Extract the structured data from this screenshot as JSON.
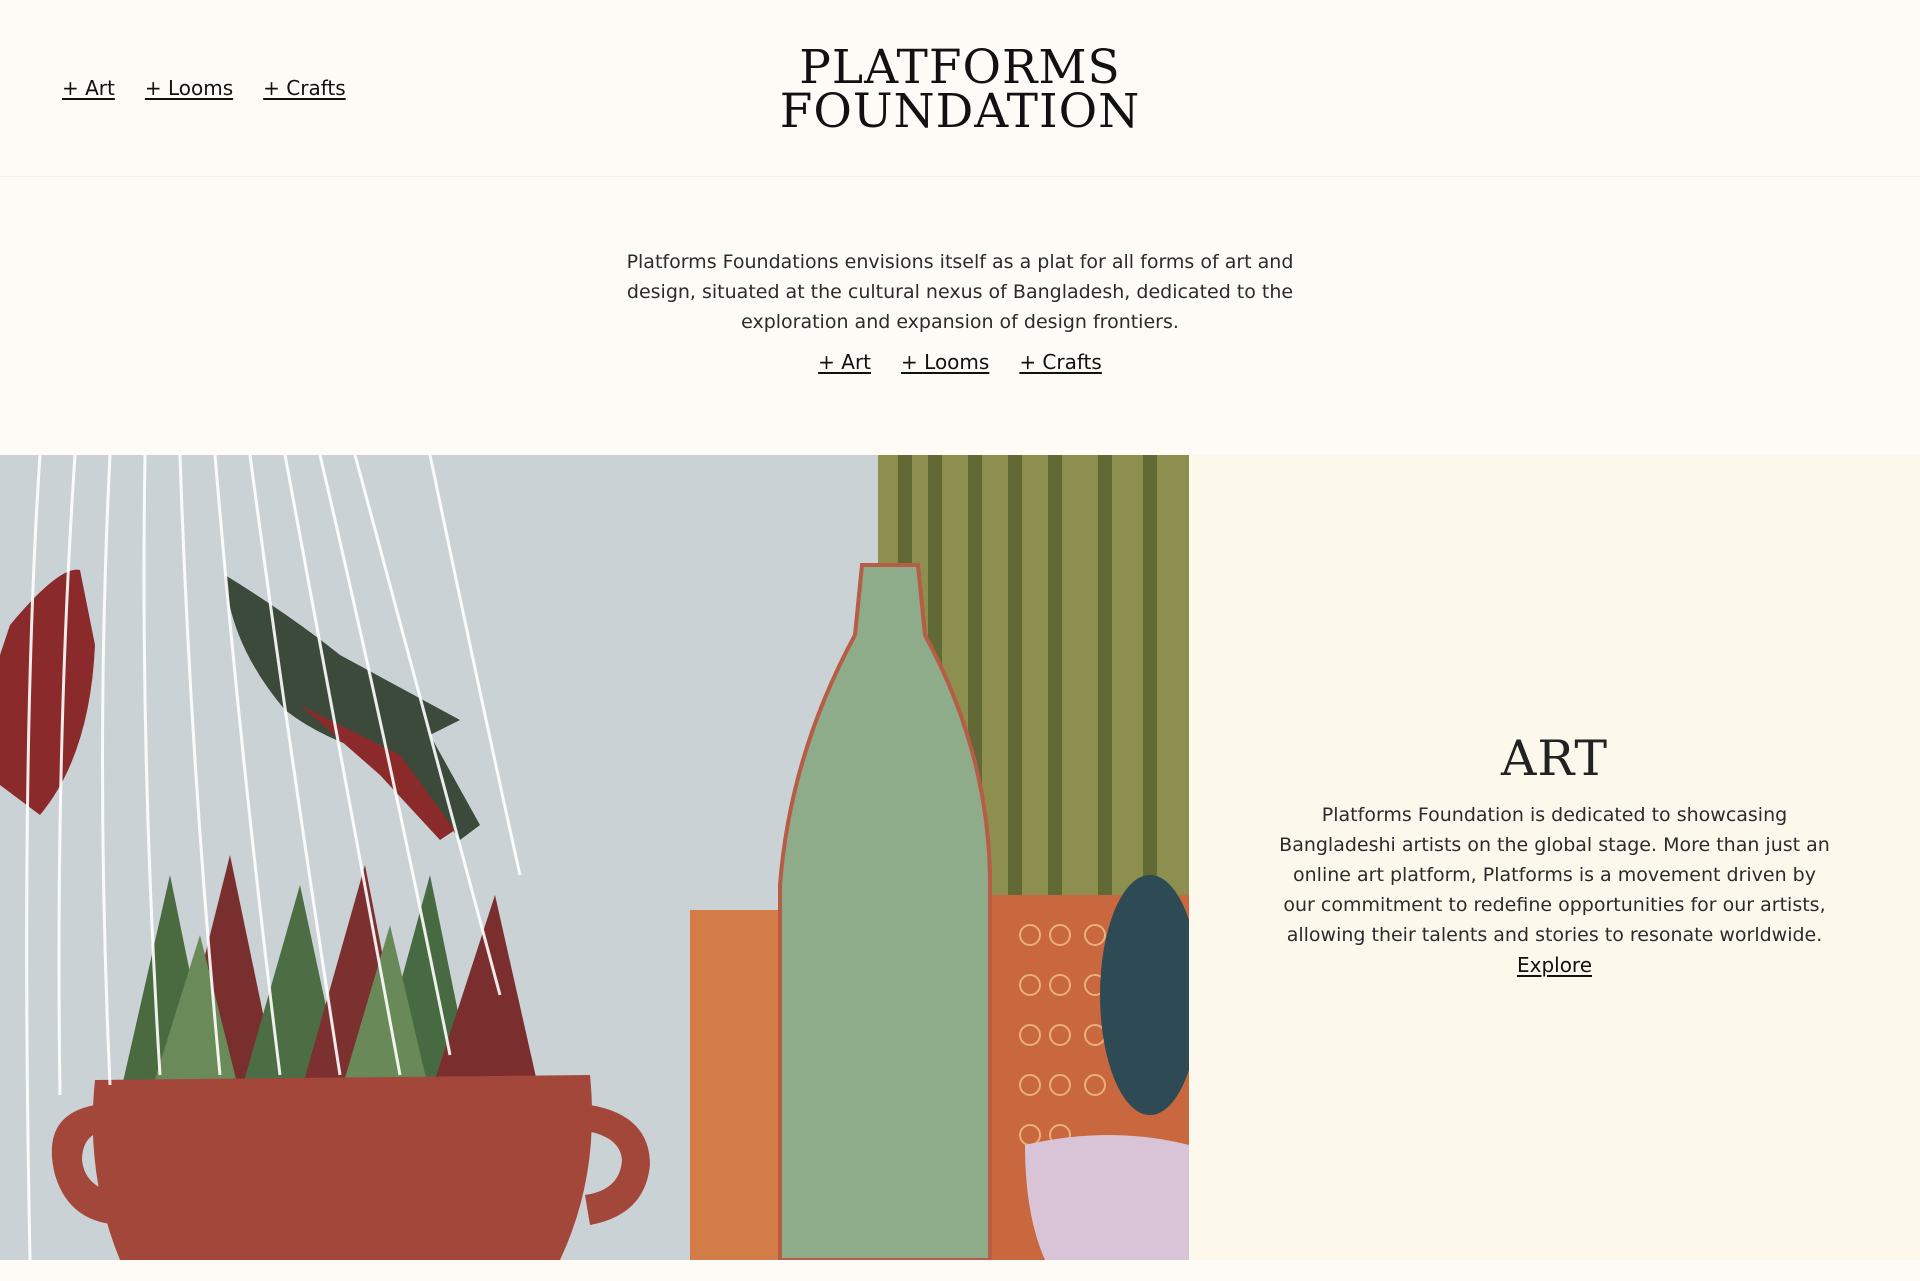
{
  "header": {
    "nav": [
      {
        "label": "+ Art"
      },
      {
        "label": "+ Looms"
      },
      {
        "label": "+ Crafts"
      }
    ],
    "logo_line1": "PLATFORMS",
    "logo_line2": "FOUNDATION"
  },
  "intro": {
    "text": "Platforms Foundations envisions itself as a plat for all forms of art and design, situated at the cultural nexus of Bangladesh, dedicated to the exploration and expansion of design frontiers.",
    "nav": [
      {
        "label": "+ Art"
      },
      {
        "label": "+ Looms"
      },
      {
        "label": "+ Crafts"
      }
    ]
  },
  "art_section": {
    "title": "ART",
    "text": "Platforms Foundation is dedicated to showcasing Bangladeshi artists on the global stage. More than just an online art platform, Platforms is a movement driven by our commitment to redefine opportunities for our artists, allowing their talents and stories to resonate worldwide.",
    "cta": "Explore"
  },
  "colors": {
    "page_background": "#fdfbf5",
    "panel_background": "#fdf8ec",
    "text": "#222222"
  }
}
